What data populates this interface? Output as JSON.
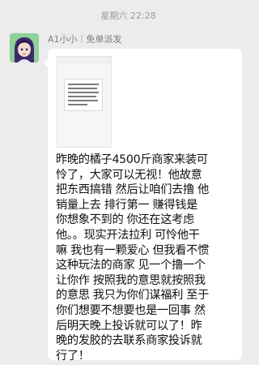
{
  "timestamp": "星期六 22:28",
  "sender": "A1小小｜免单派发",
  "avatar_icon": "anime-girl-avatar",
  "message": "昨晚的橘子4500斤商家来装可\n怜了，大家可以无视！他故意\n把东西搞错 然后让咱们去撸 他\n销量上去 排行第一 赚得钱是\n你想象不到的 你还在这考虑\n他。。现实开法拉利 可怜他干\n嘛 我也有一颗爱心 但我看不惯\n这种玩法的商家 见一个撸一个\n让你作 按照我的意思就按照我\n的意思 我只为你们谋福利 至于\n你们想要不想要也是一回事 然\n后明天晚上投诉就可以了！昨\n晚的发胶的去联系商家投诉就\n行了！"
}
